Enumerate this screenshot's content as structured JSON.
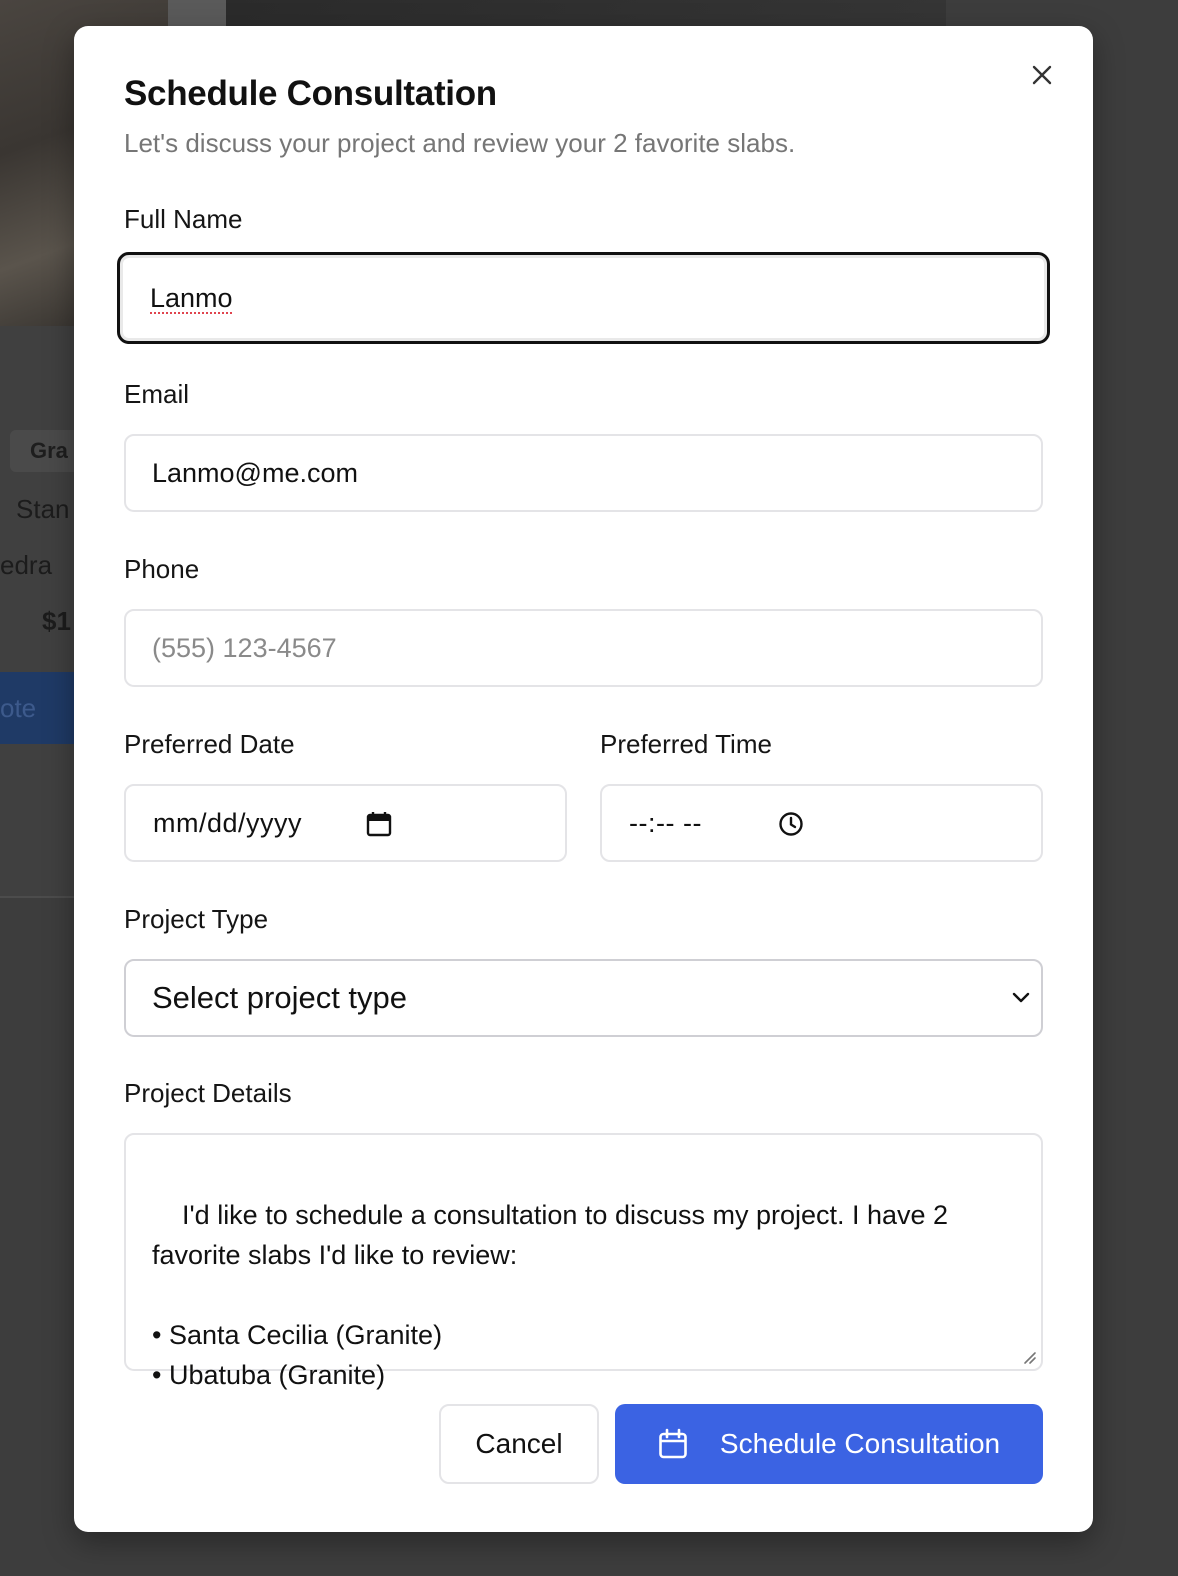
{
  "background": {
    "chip_text": "Gra",
    "line1": "Stan",
    "line2": "edra",
    "price": "$1",
    "button_text": "ote"
  },
  "modal": {
    "title": "Schedule Consultation",
    "subtitle": "Let's discuss your project and review your 2 favorite slabs.",
    "close_icon": "close-icon"
  },
  "form": {
    "full_name": {
      "label": "Full Name",
      "value": "Lanmo"
    },
    "email": {
      "label": "Email",
      "value": "Lanmo@me.com"
    },
    "phone": {
      "label": "Phone",
      "value": "",
      "placeholder": "(555) 123-4567"
    },
    "preferred_date": {
      "label": "Preferred Date",
      "placeholder": "mm/dd/yyyy",
      "icon": "calendar-icon"
    },
    "preferred_time": {
      "label": "Preferred Time",
      "placeholder": "--:-- --",
      "icon": "clock-icon"
    },
    "project_type": {
      "label": "Project Type",
      "selected": "Select project type",
      "icon": "chevron-down-icon"
    },
    "project_details": {
      "label": "Project Details",
      "value": "I'd like to schedule a consultation to discuss my project. I have 2 favorite slabs I'd like to review:\n\n• Santa Cecilia (Granite)\n• Ubatuba (Granite)"
    }
  },
  "actions": {
    "cancel_label": "Cancel",
    "submit_label": "Schedule Consultation",
    "submit_icon": "calendar-icon"
  },
  "colors": {
    "primary": "#3b63e3",
    "overlay": "#3d3d3d",
    "focus_border": "#111111",
    "spellcheck": "#e0444e"
  }
}
